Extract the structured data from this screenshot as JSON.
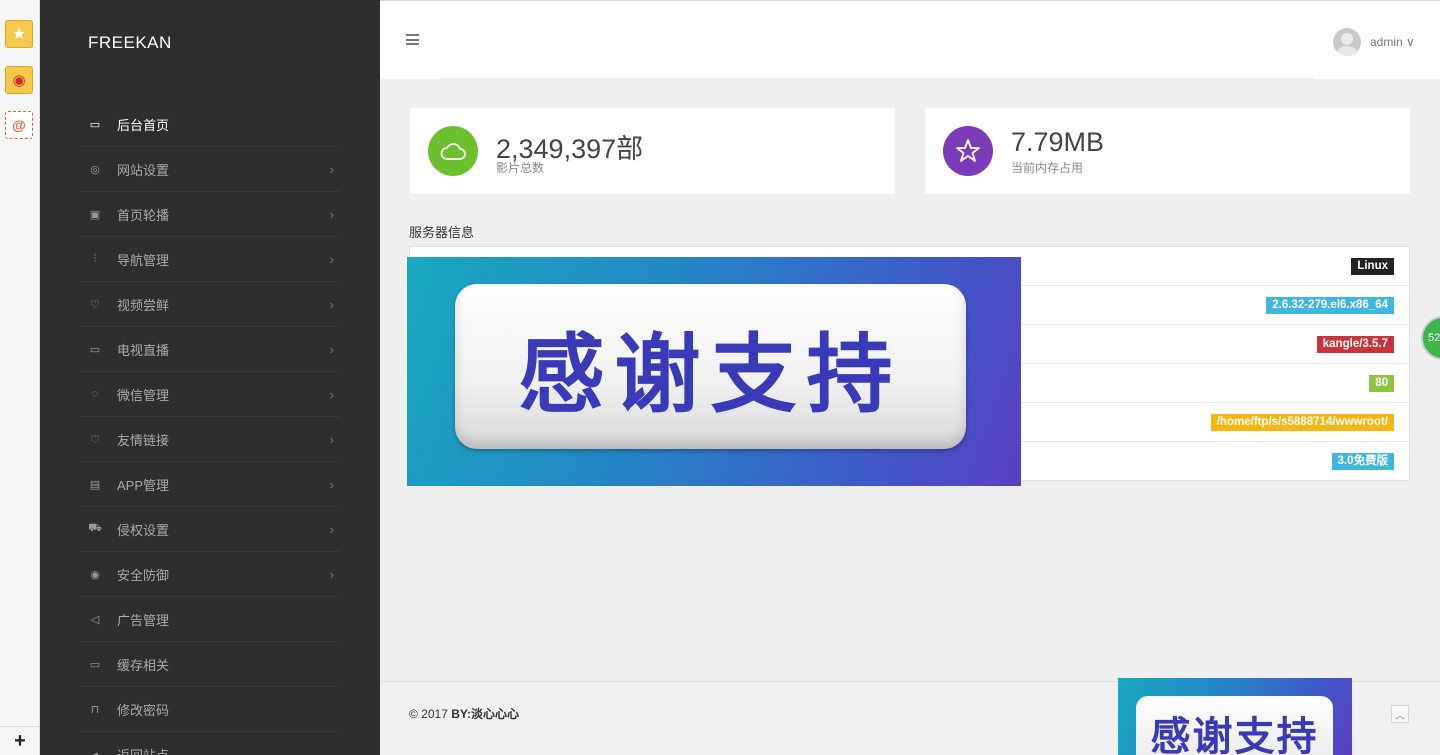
{
  "brand": "FREEKAN",
  "header": {
    "user_name": "admin ∨"
  },
  "sidebar": {
    "items": [
      {
        "label": "后台首页",
        "icon": "monitor-icon",
        "active": true,
        "has_children": false
      },
      {
        "label": "网站设置",
        "icon": "globe-icon",
        "active": false,
        "has_children": true
      },
      {
        "label": "首页轮播",
        "icon": "slides-icon",
        "active": false,
        "has_children": true
      },
      {
        "label": "导航管理",
        "icon": "sliders-icon",
        "active": false,
        "has_children": true
      },
      {
        "label": "视频尝鲜",
        "icon": "heart-icon",
        "active": false,
        "has_children": true
      },
      {
        "label": "电视直播",
        "icon": "video-camera-icon",
        "active": false,
        "has_children": true
      },
      {
        "label": "微信管理",
        "icon": "chat-bubble-icon",
        "active": false,
        "has_children": true
      },
      {
        "label": "友情链接",
        "icon": "heart-icon",
        "active": false,
        "has_children": true
      },
      {
        "label": "APP管理",
        "icon": "store-icon",
        "active": false,
        "has_children": true
      },
      {
        "label": "侵权设置",
        "icon": "truck-icon",
        "active": false,
        "has_children": true
      },
      {
        "label": "安全防御",
        "icon": "eye-icon",
        "active": false,
        "has_children": true
      },
      {
        "label": "广告管理",
        "icon": "megaphone-icon",
        "active": false,
        "has_children": false
      },
      {
        "label": "缓存相关",
        "icon": "inbox-icon",
        "active": false,
        "has_children": false
      },
      {
        "label": "修改密码",
        "icon": "lock-icon",
        "active": false,
        "has_children": false
      },
      {
        "label": "返回站点",
        "icon": "arrow-left-icon",
        "active": false,
        "has_children": false
      }
    ]
  },
  "stats": [
    {
      "value": "2,349,397部",
      "label": "影片总数",
      "icon": "cloud-icon",
      "color": "#6cbf2d"
    },
    {
      "value": "7.79MB",
      "label": "当前内存占用",
      "icon": "star-icon",
      "color": "#7b3ab8"
    }
  ],
  "server_info": {
    "title": "服务器信息",
    "rows": [
      {
        "value": "Linux",
        "color": "#222222"
      },
      {
        "value": "2.6.32-279.el6.x86_64",
        "color": "#3fb6e0"
      },
      {
        "value": "kangle/3.5.7",
        "color": "#c9333a"
      },
      {
        "value": "80",
        "color": "#8cc63f"
      },
      {
        "value": "/home/ftp/s/s5888714/wwwroot/",
        "color": "#f5b614"
      },
      {
        "value": "3.0免费版",
        "color": "#3fb6e0"
      }
    ]
  },
  "ads": {
    "big_text": "感谢支持",
    "small_text": "感谢支持"
  },
  "float_badge": "52",
  "footer": {
    "copyright": "© 2017 ",
    "by": "BY:淡心心心",
    "to_top_icon": "chevron-up-icon"
  }
}
